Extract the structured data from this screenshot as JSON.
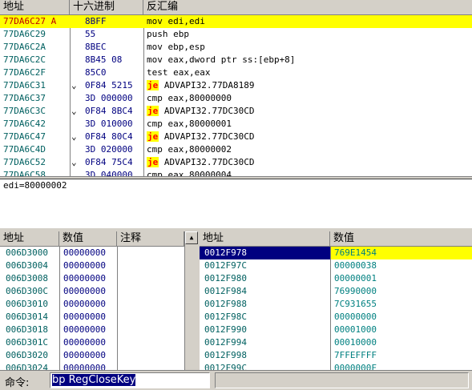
{
  "cpu": {
    "headers": {
      "address": "地址",
      "hex": "十六进制",
      "disasm": "反汇编"
    },
    "rows": [
      {
        "addr": "77DA6C27 A",
        "hex": "8BFF",
        "dis": "mov edi,edi",
        "je": false,
        "selected": true
      },
      {
        "addr": "77DA6C29",
        "hex": "55",
        "dis": "push ebp",
        "je": false
      },
      {
        "addr": "77DA6C2A",
        "hex": "8BEC",
        "dis": "mov ebp,esp",
        "je": false
      },
      {
        "addr": "77DA6C2C",
        "hex": "8B45 08",
        "dis": "mov eax,dword ptr ss:[ebp+8]",
        "je": false
      },
      {
        "addr": "77DA6C2F",
        "hex": "85C0",
        "dis": "test eax,eax",
        "je": false
      },
      {
        "addr": "77DA6C31",
        "arrow": "⌄",
        "hex": "0F84 5215",
        "je": true,
        "dis": " ADVAPI32.77DA8189"
      },
      {
        "addr": "77DA6C37",
        "hex": "3D 000000",
        "dis": "cmp eax,80000000",
        "je": false
      },
      {
        "addr": "77DA6C3C",
        "arrow": "⌄",
        "hex": "0F84 8BC4",
        "je": true,
        "dis": " ADVAPI32.77DC30CD"
      },
      {
        "addr": "77DA6C42",
        "hex": "3D 010000",
        "dis": "cmp eax,80000001",
        "je": false
      },
      {
        "addr": "77DA6C47",
        "arrow": "⌄",
        "hex": "0F84 80C4",
        "je": true,
        "dis": " ADVAPI32.77DC30CD"
      },
      {
        "addr": "77DA6C4D",
        "hex": "3D 020000",
        "dis": "cmp eax,80000002",
        "je": false
      },
      {
        "addr": "77DA6C52",
        "arrow": "⌄",
        "hex": "0F84 75C4",
        "je": true,
        "dis": " ADVAPI32.77DC30CD"
      },
      {
        "addr": "77DA6C58",
        "hex": "3D 040000",
        "dis": "cmp eax,80000004",
        "je": false
      }
    ],
    "je_label": "je"
  },
  "info": {
    "text": "edi=80000002"
  },
  "dump": {
    "headers": {
      "address": "地址",
      "value": "数值",
      "comment": "注释"
    },
    "rows": [
      {
        "addr": "006D3000",
        "val": "00000000"
      },
      {
        "addr": "006D3004",
        "val": "00000000"
      },
      {
        "addr": "006D3008",
        "val": "00000000"
      },
      {
        "addr": "006D300C",
        "val": "00000000"
      },
      {
        "addr": "006D3010",
        "val": "00000000"
      },
      {
        "addr": "006D3014",
        "val": "00000000"
      },
      {
        "addr": "006D3018",
        "val": "00000000"
      },
      {
        "addr": "006D301C",
        "val": "00000000"
      },
      {
        "addr": "006D3020",
        "val": "00000000"
      },
      {
        "addr": "006D3024",
        "val": "00000000"
      }
    ]
  },
  "stack": {
    "headers": {
      "address": "地址",
      "value": "数值"
    },
    "rows": [
      {
        "addr": "0012F978",
        "val": "769E1454",
        "selected": true
      },
      {
        "addr": "0012F97C",
        "val": "00000038"
      },
      {
        "addr": "0012F980",
        "val": "00000001"
      },
      {
        "addr": "0012F984",
        "val": "76990000"
      },
      {
        "addr": "0012F988",
        "val": "7C931655"
      },
      {
        "addr": "0012F98C",
        "val": "00000000"
      },
      {
        "addr": "0012F990",
        "val": "00001000"
      },
      {
        "addr": "0012F994",
        "val": "00010000"
      },
      {
        "addr": "0012F998",
        "val": "7FFEFFFF"
      },
      {
        "addr": "0012F99C",
        "val": "0000000F"
      }
    ]
  },
  "command": {
    "label": "命令:",
    "value": "bp RegCloseKey"
  },
  "colors": {
    "addr": "#006060",
    "hex": "#000080",
    "selected": "#ffff00",
    "je_bg": "#ffff00",
    "je_fg": "#ff0000"
  }
}
